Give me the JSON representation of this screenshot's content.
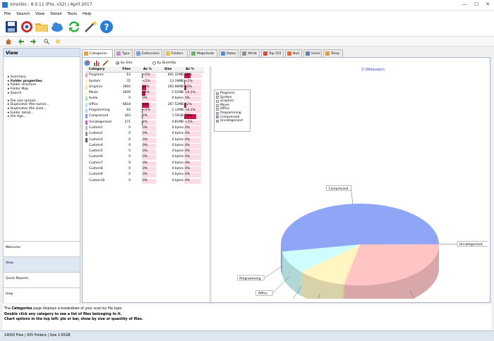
{
  "window": {
    "title": "xinorbis : 8.0.11 (Pro, x32) / April 2017",
    "controls": [
      "—",
      "☐",
      "✕"
    ]
  },
  "menu": [
    "File",
    "Search",
    "View",
    "Detail",
    "Tools",
    "Help"
  ],
  "left_panel": {
    "title": "View",
    "tree": [
      {
        "label": "Summary",
        "bold": false
      },
      {
        "label": "Folder properties",
        "bold": true
      },
      {
        "label": "Folder structure",
        "bold": false
      },
      {
        "label": "Folder Map",
        "bold": false
      },
      {
        "label": "Search",
        "bold": false
      },
      {
        "gap": true
      },
      {
        "label": "File size spread...",
        "bold": false
      },
      {
        "label": "Duplicates (file name)...",
        "bold": false
      },
      {
        "label": "Duplicates (file size)...",
        "bold": false
      },
      {
        "label": "Folder detail...",
        "bold": false
      },
      {
        "label": "File Age...",
        "bold": false
      }
    ],
    "nav_tabs": [
      {
        "label": "Welcome",
        "selected": false
      },
      {
        "label": "View",
        "selected": true
      },
      {
        "label": "Quick Reports",
        "selected": false
      },
      {
        "label": "Help",
        "selected": false
      }
    ]
  },
  "tabs": [
    {
      "label": "Categories",
      "color": "#e8a040",
      "selected": true,
      "w": 44
    },
    {
      "label": "Type",
      "color": "#c090d0",
      "selected": false,
      "w": 26
    },
    {
      "label": "Extensions",
      "color": "#7aa0d8",
      "selected": false,
      "w": 40
    },
    {
      "label": "Folders",
      "color": "#e8c050",
      "selected": false,
      "w": 34
    },
    {
      "label": "Magnitude",
      "color": "#70b070",
      "selected": false,
      "w": 40
    },
    {
      "label": "Dates",
      "color": "#5a8ad0",
      "selected": false,
      "w": 28
    },
    {
      "label": "Attrib",
      "color": "#909090",
      "selected": false,
      "w": 28
    },
    {
      "label": "Top 101",
      "color": "#d05050",
      "selected": false,
      "w": 32
    },
    {
      "label": "Null",
      "color": "#e07030",
      "selected": false,
      "w": 24
    },
    {
      "label": "Users",
      "color": "#6080b0",
      "selected": false,
      "w": 26
    },
    {
      "label": "Temp",
      "color": "#e0a040",
      "selected": false,
      "w": 28
    }
  ],
  "options": {
    "by_size": "by Size",
    "by_quantity": "by Quantity",
    "selected": "by_size"
  },
  "table": {
    "headers": {
      "category": "Category",
      "files": "Files",
      "files_pct": "As %",
      "size": "Size",
      "size_pct": "As %"
    },
    "rows": [
      {
        "category": "Programs",
        "files": "63",
        "files_pct": "<1%",
        "size": "841.31MB",
        "size_pct": "38%",
        "fbar": 0.004,
        "sbar": 0.38,
        "color": "#f2a0a0"
      },
      {
        "category": "System",
        "files": "35",
        "files_pct": "<1%",
        "size": "13.19MB",
        "size_pct": "<1%",
        "fbar": 0.002,
        "sbar": 0.006,
        "color": "#fff2b0"
      },
      {
        "category": "Graphics",
        "files": "3904",
        "files_pct": "28%",
        "size": "292.96MB",
        "size_pct": "13%",
        "fbar": 0.28,
        "sbar": 0.13,
        "color": "#f8e890"
      },
      {
        "category": "Movie",
        "files": "3609",
        "files_pct": "26%",
        "size": "2.51MB",
        "size_pct": "<0.1%",
        "fbar": 0.26,
        "sbar": 0.001,
        "color": "#fff8c0"
      },
      {
        "category": "Audio",
        "files": "0",
        "files_pct": "0%",
        "size": "0 bytes",
        "size_pct": "0%",
        "fbar": 0,
        "sbar": 0,
        "color": "#a0e8a0"
      },
      {
        "category": "Office",
        "files": "6818",
        "files_pct": "49%",
        "size": "267.52MB",
        "size_pct": "12%",
        "fbar": 0.49,
        "sbar": 0.12,
        "color": "#a0f0f0"
      },
      {
        "category": "Programming",
        "files": "64",
        "files_pct": "<1%",
        "size": "2.12MB",
        "size_pct": "<0.1%",
        "fbar": 0.004,
        "sbar": 0.001,
        "color": "#b0d8ff"
      },
      {
        "category": "Compressed",
        "files": "303",
        "files_pct": "2%",
        "size": "1.55GB",
        "size_pct": "71%",
        "fbar": 0.02,
        "sbar": 0.71,
        "color": "#8090f0"
      },
      {
        "category": "Uncategorised",
        "files": "271",
        "files_pct": "2%",
        "size": "4.81MB",
        "size_pct": "<1%",
        "fbar": 0.02,
        "sbar": 0.002,
        "color": "#c060c0"
      },
      {
        "category": "Custom1",
        "files": "0",
        "files_pct": "0%",
        "size": "0 bytes",
        "size_pct": "0%",
        "fbar": 0,
        "sbar": 0,
        "color": "#c0c0c0"
      },
      {
        "category": "Custom2",
        "files": "0",
        "files_pct": "0%",
        "size": "0 bytes",
        "size_pct": "0%",
        "fbar": 0,
        "sbar": 0,
        "color": "#909090"
      },
      {
        "category": "Custom3",
        "files": "0",
        "files_pct": "0%",
        "size": "0 bytes",
        "size_pct": "0%",
        "fbar": 0,
        "sbar": 0,
        "color": "#606060"
      },
      {
        "category": "Custom4",
        "files": "0",
        "files_pct": "0%",
        "size": "0 bytes",
        "size_pct": "0%",
        "fbar": 0,
        "sbar": 0,
        "color": ""
      },
      {
        "category": "Custom5",
        "files": "0",
        "files_pct": "0%",
        "size": "0 bytes",
        "size_pct": "0%",
        "fbar": 0,
        "sbar": 0,
        "color": ""
      },
      {
        "category": "Custom6",
        "files": "0",
        "files_pct": "0%",
        "size": "0 bytes",
        "size_pct": "0%",
        "fbar": 0,
        "sbar": 0,
        "color": ""
      },
      {
        "category": "Custom7",
        "files": "0",
        "files_pct": "0%",
        "size": "0 bytes",
        "size_pct": "0%",
        "fbar": 0,
        "sbar": 0,
        "color": ""
      },
      {
        "category": "Custom8",
        "files": "0",
        "files_pct": "0%",
        "size": "0 bytes",
        "size_pct": "0%",
        "fbar": 0,
        "sbar": 0,
        "color": ""
      },
      {
        "category": "Custom9",
        "files": "0",
        "files_pct": "0%",
        "size": "0 bytes",
        "size_pct": "0%",
        "fbar": 0,
        "sbar": 0,
        "color": ""
      },
      {
        "category": "Custom10",
        "files": "0",
        "files_pct": "0%",
        "size": "0 bytes",
        "size_pct": "0%",
        "fbar": 0,
        "sbar": 0,
        "color": ""
      }
    ]
  },
  "chart_data": {
    "type": "pie",
    "title": "Z:\\Webpages\\",
    "legend_position": "top-left",
    "labels": [
      "Programs",
      "System",
      "Graphics",
      "Movie",
      "Office",
      "Programming",
      "Compressed",
      "Uncategorised"
    ],
    "values": [
      38,
      0.6,
      13,
      0.1,
      12,
      0.1,
      71,
      0.2
    ],
    "colors": [
      "#ffc4c4",
      "#ffe9b0",
      "#fff6c4",
      "#fffbd4",
      "#cffcfc",
      "#c2ddff",
      "#8ea6f5",
      "#d7a7ec"
    ]
  },
  "info": {
    "line1_a": "The ",
    "line1_b": "Categories",
    "line1_c": " page displays a breakdown of your scan by file type.",
    "line2": "Double click any category to see a list of files belonging to it.",
    "line3": "Chart options in the top left: pie or bar, show by size or quantity of files."
  },
  "status": "14093 Files  |  935 Folders  |  Size 2.65GB"
}
